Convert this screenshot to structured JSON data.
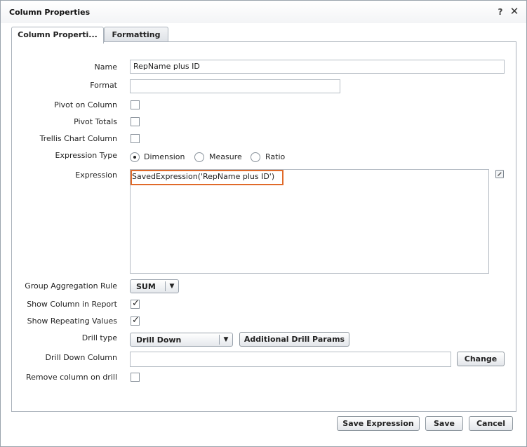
{
  "dialog": {
    "title": "Column Properties",
    "help_glyph": "?",
    "close_glyph": "✕"
  },
  "tabs": [
    {
      "label": "Column Properti..."
    },
    {
      "label": "Formatting"
    }
  ],
  "form": {
    "name_label": "Name",
    "name_value": "RepName plus ID",
    "format_label": "Format",
    "format_value": "",
    "pivot_label": "Pivot on Column",
    "pivot_checked": false,
    "pivot_totals_label": "Pivot Totals",
    "pivot_totals_checked": false,
    "trellis_label": "Trellis Chart Column",
    "trellis_checked": false,
    "expression_type_label": "Expression Type",
    "expression_types": [
      "Dimension",
      "Measure",
      "Ratio"
    ],
    "expression_type_selected": "Dimension",
    "expression_label": "Expression",
    "expression_value": "SavedExpression('RepName plus ID')",
    "group_agg_label": "Group Aggregation Rule",
    "group_agg_value": "SUM",
    "show_column_label": "Show Column in Report",
    "show_column_checked": true,
    "show_repeating_label": "Show Repeating Values",
    "show_repeating_checked": true,
    "drill_type_label": "Drill type",
    "drill_type_value": "Drill Down",
    "additional_drill_label": "Additional Drill Params",
    "drill_down_column_label": "Drill Down Column",
    "drill_down_column_value": "",
    "change_label": "Change",
    "remove_column_label": "Remove column on drill",
    "remove_column_checked": false
  },
  "footer": {
    "save_expression_label": "Save Expression",
    "save_label": "Save",
    "cancel_label": "Cancel"
  },
  "colors": {
    "highlight": "#e06a2a",
    "border": "#aab2bb"
  },
  "icons": {
    "help": "help-icon",
    "close": "close-icon",
    "edit": "pencil-icon",
    "dropdown": "chevron-down-icon",
    "check": "checkmark-icon"
  }
}
